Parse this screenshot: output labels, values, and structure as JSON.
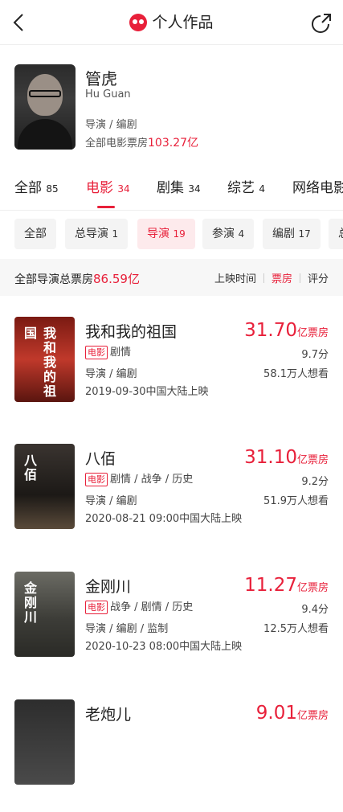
{
  "nav": {
    "title": "个人作品"
  },
  "profile": {
    "name": "管虎",
    "en_name": "Hu Guan",
    "roles": "导演 / 编剧",
    "box_label": "全部电影票房",
    "box_value": "103.27亿"
  },
  "tabs": [
    {
      "label": "全部",
      "count": "85"
    },
    {
      "label": "电影",
      "count": "34",
      "active": true
    },
    {
      "label": "剧集",
      "count": "34"
    },
    {
      "label": "综艺",
      "count": "4"
    },
    {
      "label": "网络电影",
      "count": ""
    }
  ],
  "chips": [
    {
      "label": "全部",
      "count": ""
    },
    {
      "label": "总导演",
      "count": "1"
    },
    {
      "label": "导演",
      "count": "19",
      "active": true
    },
    {
      "label": "参演",
      "count": "4"
    },
    {
      "label": "编剧",
      "count": "17"
    },
    {
      "label": "总",
      "count": ""
    }
  ],
  "summary": {
    "label": "全部导演总票房",
    "value": "86.59亿",
    "sorts": [
      "上映时间",
      "票房",
      "评分"
    ],
    "active_sort": "票房"
  },
  "films": [
    {
      "title": "我和我的祖国",
      "box": "31.70",
      "box_unit": "亿票房",
      "tag": "电影",
      "genre": "剧情",
      "score": "9.7分",
      "role": "导演 / 编剧",
      "want": "58.1万人想看",
      "release": "2019-09-30中国大陆上映",
      "poster_text": "我和我的祖国",
      "poster_color": "#b5291d"
    },
    {
      "title": "八佰",
      "box": "31.10",
      "box_unit": "亿票房",
      "tag": "电影",
      "genre": "剧情 / 战争 / 历史",
      "score": "9.2分",
      "role": "导演 / 编剧",
      "want": "51.9万人想看",
      "release": "2020-08-21 09:00中国大陆上映",
      "poster_text": "八佰",
      "poster_color": "#2a2622"
    },
    {
      "title": "金刚川",
      "box": "11.27",
      "box_unit": "亿票房",
      "tag": "电影",
      "genre": "战争 / 剧情 / 历史",
      "score": "9.4分",
      "role": "导演 / 编剧 / 监制",
      "want": "12.5万人想看",
      "release": "2020-10-23 08:00中国大陆上映",
      "poster_text": "金刚川",
      "poster_color": "#4a4a44"
    },
    {
      "title": "老炮儿",
      "box": "9.01",
      "box_unit": "亿票房",
      "tag": "",
      "genre": "",
      "score": "",
      "role": "",
      "want": "",
      "release": "",
      "poster_text": "",
      "poster_color": "#2d2d2d"
    }
  ],
  "colors": {
    "accent": "#e8203a"
  }
}
